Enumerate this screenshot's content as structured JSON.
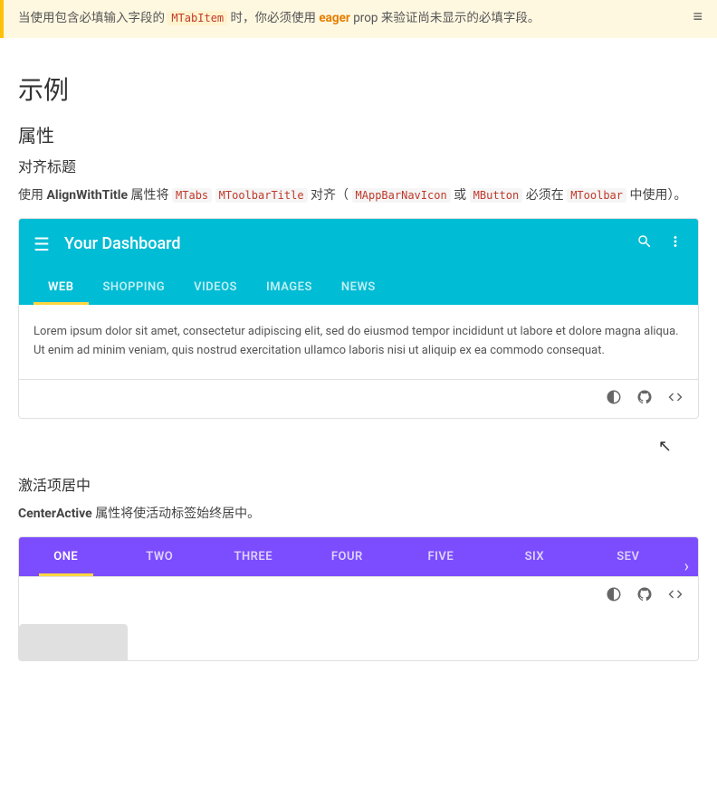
{
  "warning": {
    "text_part1": "当使用包含必填输入字段的",
    "mono1": "MTabItem",
    "text_part2": "时，你必须使用",
    "bold1": "eager",
    "text_part3": "prop 来验证尚未显示的必填字段。"
  },
  "top_right_icon": "≡",
  "section_title": "示例",
  "subsection1": {
    "heading": "属性",
    "subheading": "对齐标题",
    "description_part1": "使用",
    "bold1": "AlignWithTitle",
    "description_part2": "属性将",
    "mono1": "MTabs",
    "mono2": "MToolbarTitle",
    "description_part3": "对齐（",
    "mono3": "MAppBarNavIcon",
    "description_part4": "或",
    "mono4": "MButton",
    "description_part5": "必须在",
    "mono5": "MToolbar",
    "description_part6": "中使用）。"
  },
  "demo1": {
    "toolbar": {
      "title": "Your Dashboard",
      "menu_icon": "☰",
      "search_icon": "🔍",
      "more_icon": "⋮"
    },
    "tabs": [
      {
        "label": "WEB",
        "active": true
      },
      {
        "label": "SHOPPING",
        "active": false
      },
      {
        "label": "VIDEOS",
        "active": false
      },
      {
        "label": "IMAGES",
        "active": false
      },
      {
        "label": "NEWS",
        "active": false
      }
    ],
    "content": "Lorem ipsum dolor sit amet, consectetur adipiscing elit, sed do eiusmod tempor incididunt ut labore et dolore magna aliqua. Ut enim ad minim veniam, quis nostrud exercitation ullamco laboris nisi ut aliquip ex ea commodo consequat.",
    "footer_icons": [
      "contrast",
      "github",
      "code"
    ]
  },
  "subsection2": {
    "heading": "激活项居中",
    "description_bold": "CenterActive",
    "description_rest": "属性将使活动标签始终居中。"
  },
  "demo2": {
    "tabs": [
      {
        "label": "ONE",
        "active": true
      },
      {
        "label": "TWO",
        "active": false
      },
      {
        "label": "THREE",
        "active": false
      },
      {
        "label": "FOUR",
        "active": false
      },
      {
        "label": "FIVE",
        "active": false
      },
      {
        "label": "SIX",
        "active": false
      },
      {
        "label": "SEV",
        "active": false
      }
    ],
    "arrow": "›",
    "footer_icons": [
      "contrast",
      "github",
      "code"
    ]
  },
  "colors": {
    "cyan": "#00bcd4",
    "purple": "#7c4dff",
    "yellow_indicator": "#ffd740",
    "warning_bg": "#fff8e1",
    "warning_border": "#ffc107"
  }
}
